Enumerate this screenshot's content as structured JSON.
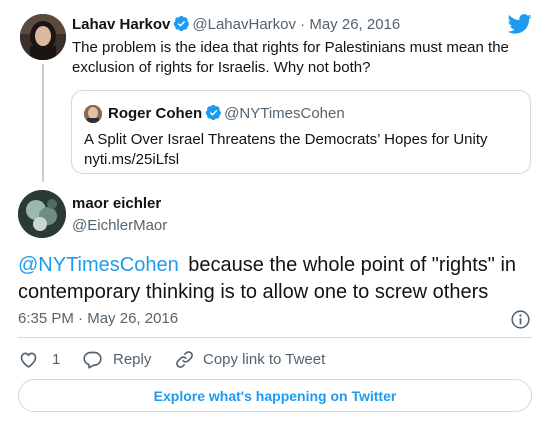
{
  "parent_tweet": {
    "author_name": "Lahav Harkov",
    "author_handle": "@LahavHarkov",
    "separator": "·",
    "date": "May 26, 2016",
    "text": "The problem is the idea that rights for Palestinians must mean the exclusion of rights for Israelis. Why not both?",
    "quoted_tweet": {
      "author_name": "Roger Cohen",
      "author_handle": "@NYTimesCohen",
      "text": "A Split Over Israel Threatens the Democrats’ Hopes for Unity",
      "link": "nyti.ms/25iLfsl"
    }
  },
  "main_tweet": {
    "author_name": "maor eichler",
    "author_handle": "@EichlerMaor",
    "mention": "@NYTimesCohen",
    "text": "because the whole point of \"rights\" in contemporary thinking is to allow one to screw others",
    "time": "6:35 PM",
    "separator": "·",
    "date": "May 26, 2016"
  },
  "actions": {
    "like_count": "1",
    "reply_label": "Reply",
    "copy_label": "Copy link to Tweet"
  },
  "explore_label": "Explore what's happening on Twitter",
  "colors": {
    "accent": "#1d9bf0",
    "text": "#0f1419",
    "muted": "#536471",
    "border": "#cfd9de"
  },
  "icons": [
    "twitter-bird-icon",
    "verified-badge-icon",
    "info-icon",
    "heart-icon",
    "reply-bubble-icon",
    "link-icon"
  ]
}
